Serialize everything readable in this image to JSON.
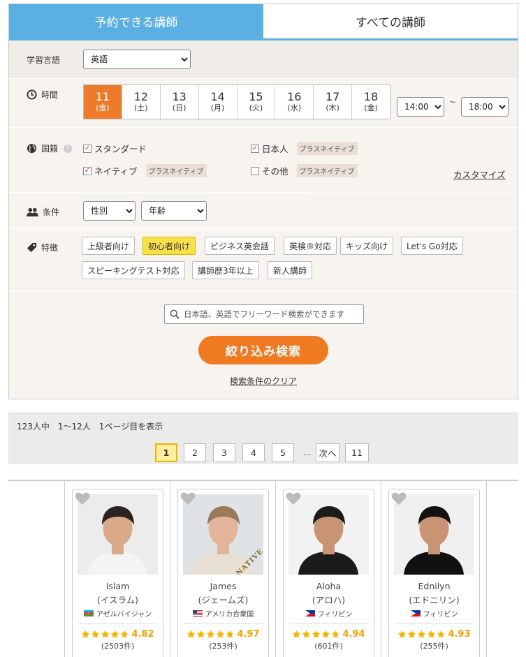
{
  "tabs": {
    "active": "予約できる講師",
    "inactive": "すべての講師"
  },
  "language": {
    "label": "学習言語",
    "value": "英語"
  },
  "time": {
    "label": "時間",
    "days": [
      {
        "date": "11",
        "weekday": "(金)",
        "selected": true
      },
      {
        "date": "12",
        "weekday": "(土)",
        "selected": false
      },
      {
        "date": "13",
        "weekday": "(日)",
        "selected": false
      },
      {
        "date": "14",
        "weekday": "(月)",
        "selected": false
      },
      {
        "date": "15",
        "weekday": "(火)",
        "selected": false
      },
      {
        "date": "16",
        "weekday": "(水)",
        "selected": false
      },
      {
        "date": "17",
        "weekday": "(木)",
        "selected": false
      },
      {
        "date": "18",
        "weekday": "(金)",
        "selected": false
      }
    ],
    "from": "14:00",
    "separator": "~",
    "to": "18:00"
  },
  "nationality": {
    "label": "国籍",
    "options": [
      {
        "label": "スタンダード",
        "checked": true,
        "tag": ""
      },
      {
        "label": "日本人",
        "checked": true,
        "tag": "プラスネイティブ"
      },
      {
        "label": "ネイティブ",
        "checked": true,
        "tag": "プラスネイティブ"
      },
      {
        "label": "その他",
        "checked": false,
        "tag": "プラスネイティブ"
      }
    ],
    "customize": "カスタマイズ"
  },
  "conditions": {
    "label": "条件",
    "gender": "性別",
    "age": "年齢"
  },
  "features": {
    "label": "特徴",
    "tags": [
      {
        "label": "上級者向け",
        "active": false
      },
      {
        "label": "初心者向け",
        "active": true
      },
      {
        "label": "ビジネス英会話",
        "active": false
      },
      {
        "label": "英検®対応",
        "active": false
      },
      {
        "label": "キッズ向け",
        "active": false
      },
      {
        "label": "Let's Go対応",
        "active": false
      },
      {
        "label": "スピーキングテスト対応",
        "active": false
      },
      {
        "label": "講師歴3年以上",
        "active": false
      },
      {
        "label": "新人講師",
        "active": false
      }
    ]
  },
  "search": {
    "placeholder": "日本語、英語でフリーワード検索ができます",
    "button": "絞り込み検索",
    "clear": "検索条件のクリア"
  },
  "results": {
    "summary": "123人中　1〜12人　1ページ目を表示",
    "pages": [
      "1",
      "2",
      "3",
      "4",
      "5"
    ],
    "ellipsis": "...",
    "next": "次へ",
    "last": "11"
  },
  "teachers": [
    {
      "name": "Islam",
      "kana": "(イスラム)",
      "country": "アゼルバイジャン",
      "flag": "azerbaijan",
      "rating": 4.82,
      "reviews": "(2503件)",
      "native": false
    },
    {
      "name": "James",
      "kana": "(ジェームズ)",
      "country": "アメリカ合衆国",
      "flag": "usa",
      "rating": 4.97,
      "reviews": "(253件)",
      "native": true,
      "native_label": "NATIVE"
    },
    {
      "name": "Aloha",
      "kana": "(アロハ)",
      "country": "フィリピン",
      "flag": "philippines",
      "rating": 4.94,
      "reviews": "(601件)",
      "native": false
    },
    {
      "name": "Ednilyn",
      "kana": "(エドニリン)",
      "country": "フィリピン",
      "flag": "philippines",
      "rating": 4.93,
      "reviews": "(255件)",
      "native": false
    }
  ],
  "colors": {
    "tab_active": "#5ab0e3",
    "accent_orange": "#f07a22",
    "highlight_yellow": "#f7e04a",
    "star": "#f0a100"
  }
}
